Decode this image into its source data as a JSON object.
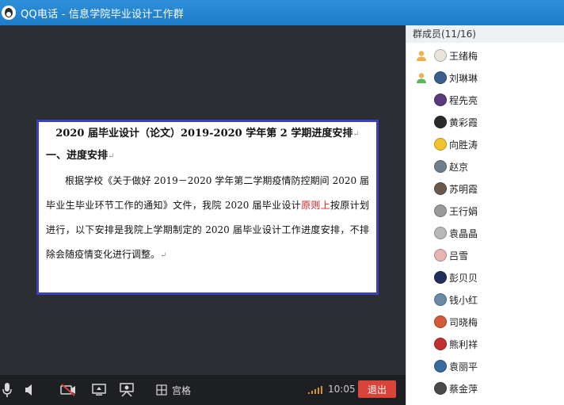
{
  "window": {
    "title": "QQ电话 - 信息学院毕业设计工作群"
  },
  "document": {
    "title": "2020 届毕业设计（论文）2019-2020 学年第 2 学期进度安排",
    "heading": "一、进度安排",
    "paragraph_part1": "根据学校《关于做好 2019－2020 学年第二学期疫情防控期间 2020 届毕业生毕业环节工作的通知》文件，我院 2020 届毕业设计",
    "paragraph_red": "原则上",
    "paragraph_part2": "按原计划进行，以下安排是我院上学期制定的 2020 届毕业设计工作进度安排，不排除会随疫情变化进行调整。",
    "paragraph_mark": "↵",
    "title_mark": "↵",
    "heading_mark": "↵"
  },
  "controls": {
    "grid_label": "宫格",
    "time": "10:05",
    "exit_label": "退出"
  },
  "sidebar": {
    "header": "群成员(11/16)",
    "members": [
      {
        "name": "王绪梅",
        "avatar_color": "#e9e4dc"
      },
      {
        "name": "刘琳琳",
        "avatar_color": "#3b5f8a"
      },
      {
        "name": "程先亮",
        "avatar_color": "#5a3a7a"
      },
      {
        "name": "黄彩霞",
        "avatar_color": "#2a2a2a"
      },
      {
        "name": "向胜涛",
        "avatar_color": "#f2c230"
      },
      {
        "name": "赵京",
        "avatar_color": "#6d7f8e"
      },
      {
        "name": "苏明霞",
        "avatar_color": "#6a5a4e"
      },
      {
        "name": "王行娟",
        "avatar_color": "#9a9a9a"
      },
      {
        "name": "袁晶晶",
        "avatar_color": "#b8b8b8"
      },
      {
        "name": "吕雪",
        "avatar_color": "#e7b3b3"
      },
      {
        "name": "彭贝贝",
        "avatar_color": "#20305a"
      },
      {
        "name": "钱小红",
        "avatar_color": "#6b8aa8"
      },
      {
        "name": "司晓梅",
        "avatar_color": "#d35a3a"
      },
      {
        "name": "熊利祥",
        "avatar_color": "#c03030"
      },
      {
        "name": "袁丽平",
        "avatar_color": "#3a6aa0"
      },
      {
        "name": "蔡金萍",
        "avatar_color": "#4a4a4a"
      }
    ]
  },
  "colors": {
    "titlebar": "#2384d0",
    "exit_button": "#d9433a",
    "doc_border": "#3b3fc2"
  }
}
